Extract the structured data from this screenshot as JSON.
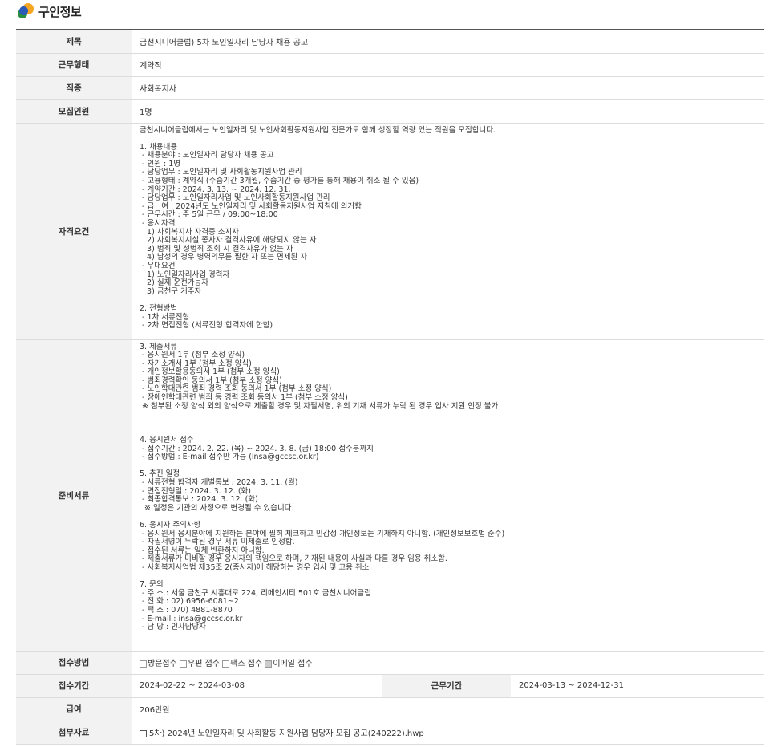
{
  "header": {
    "title": "구인정보"
  },
  "rows": {
    "title": {
      "label": "제목",
      "value": "금천시니어클럽) 5차 노인일자리 담당자 채용 공고"
    },
    "work_type": {
      "label": "근무형태",
      "value": "계약직"
    },
    "job": {
      "label": "직종",
      "value": "사회복지사"
    },
    "openings": {
      "label": "모집인원",
      "value": "1명"
    },
    "qualifications": {
      "label": "자격요건",
      "text": "금천시니어클럽에서는 노인일자리 및 노인사회활동지원사업 전문가로 함께 성장할 역량 있는 직원을 모집합니다.\n\n1. 채용내용\n - 채용분야 : 노인일자리 담당자 채용 공고\n - 인원 : 1명\n - 담당업무 : 노인일자리 및 사회활동지원사업 관리\n - 고용형태 : 계약직 (수습기간 3개월, 수습기간 중 평가를 통해 채용이 취소 될 수 있음)\n - 계약기간 : 2024. 3. 13. ~ 2024. 12. 31.\n - 담당업무 : 노인일자리사업 및 노인사회활동지원사업 관리\n - 급   여 : 2024년도 노인일자리 및 사회활동지원사업 지침에 의거함\n - 근무시간 : 주 5일 근무 / 09:00~18:00\n - 응시자격\n   1) 사회복지사 자격증 소지자\n   2) 사회복지시설 종사자 결격사유에 해당되지 않는 자\n   3) 범죄 및 성범죄 조회 시 결격사유가 없는 자\n   4) 남성의 경우 병역의무를 필한 자 또는 면제된 자\n - 우대요건\n   1) 노인일자리사업 경력자\n   2) 실제 운전가능자\n   3) 금천구 거주자\n\n2. 전형방법\n - 1차 서류전형\n - 2차 면접전형 (서류전형 합격자에 한함)"
    },
    "documents": {
      "label": "준비서류",
      "text": "3. 제출서류\n - 응시원서 1부 (첨부 소정 양식)\n - 자기소개서 1부 (첨부 소정 양식)\n - 개인정보활용동의서 1부 (첨부 소정 양식)\n - 범죄경력확인 동의서 1부 (첨부 소정 양식)\n - 노인학대관련 범죄 경력 조회 동의서 1부 (첨부 소정 양식)\n - 장애인학대관련 범죄 등 경력 조회 동의서 1부 (첨부 소정 양식)\n ※ 첨부된 소정 양식 외의 양식으로 제출할 경우 및 자필서명, 위의 기재 서류가 누락 된 경우 입사 지원 인정 불가\n\n\n\n4. 응시원서 접수\n - 접수기간 : 2024. 2. 22. (목) ~ 2024. 3. 8. (금) 18:00 접수분까지\n - 접수방법 : E-mail 접수만 가능 (insa@gccsc.or.kr)\n\n5. 추진 일정\n - 서류전형 합격자 개별통보 : 2024. 3. 11. (월)\n - 면접전형일 : 2024. 3. 12. (화)\n - 최종합격통보 : 2024. 3. 12. (화)\n  ※ 일정은 기관의 사정으로 변경될 수 있습니다.\n\n6. 응시자 주의사항\n - 응시원서 응시분야에 지원하는 분야에 필히 체크하고 민감성 개인정보는 기재하지 아니함. (개인정보보호법 준수)\n - 자필서명이 누락된 경우 서류 미제출로 인정함.\n - 접수된 서류는 일체 반환하지 아니함.\n - 제출서류가 미비할 경우 응시자의 책임으로 하며, 기재된 내용이 사실과 다를 경우 임용 취소함.\n - 사회복지사업법 제35조 2(종사자)에 해당하는 경우 입사 및 고용 취소\n\n7. 문의\n - 주 소 : 서울 금천구 시흥대로 224, 리메인시티 501호 금천시니어클럽\n - 전 화 : 02) 6956-6081~2\n - 팩 스 : 070) 4881-8870\n - E-mail : insa@gccsc.or.kr\n - 담 당 : 인사담당자"
    },
    "apply_method": {
      "label": "접수방법",
      "options": [
        {
          "label": "방문접수",
          "checked": false
        },
        {
          "label": "우편 접수",
          "checked": false
        },
        {
          "label": "팩스 접수",
          "checked": false
        },
        {
          "label": "이메일 접수",
          "checked": true
        }
      ]
    },
    "period": {
      "label": "접수기간",
      "value": "2024-02-22 ~ 2024-03-08",
      "work_label": "근무기간",
      "work_value": "2024-03-13 ~ 2024-12-31"
    },
    "salary": {
      "label": "급여",
      "value": "206만원"
    },
    "attachment": {
      "label": "첨부자료",
      "file": "5차) 2024년 노인일자리 및 사회활동 지원사업 담당자 모집 공고(240222).hwp"
    }
  }
}
